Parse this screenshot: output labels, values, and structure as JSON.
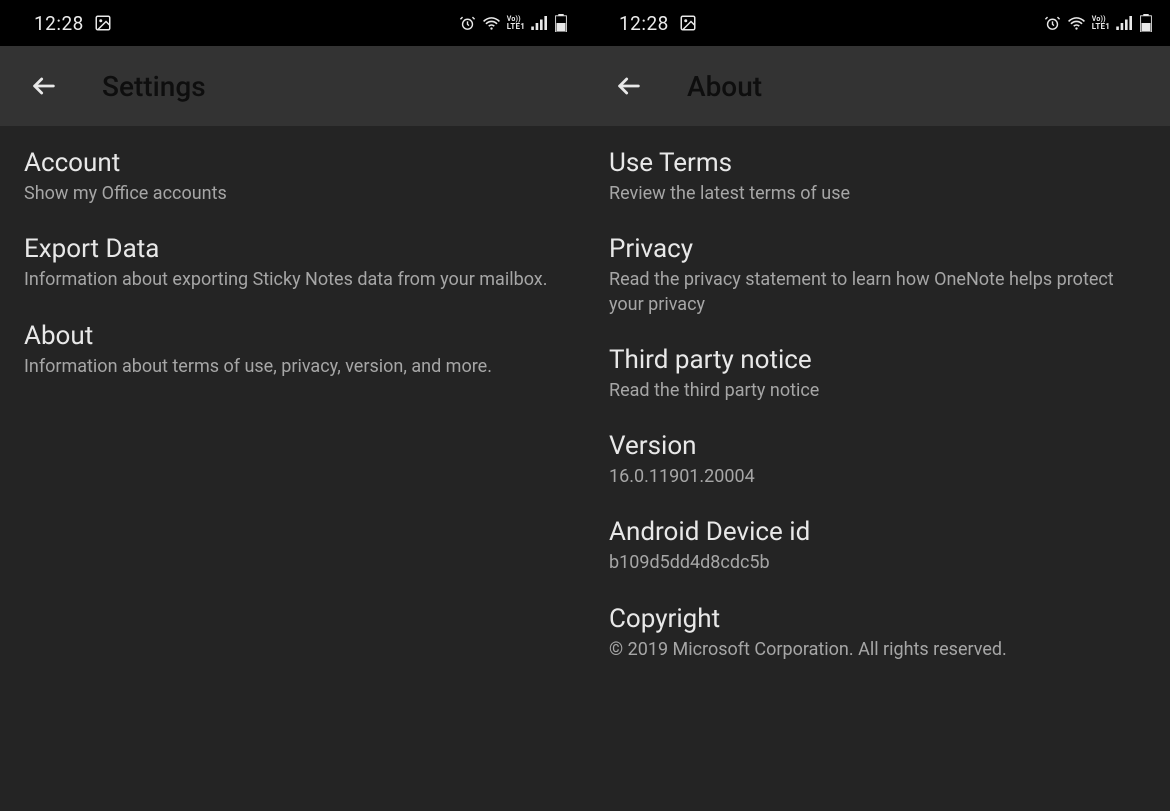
{
  "status": {
    "time": "12:28",
    "lte": "LTE1",
    "vo": "Vo))"
  },
  "left": {
    "appbar": {
      "title": "Settings"
    },
    "items": [
      {
        "title": "Account",
        "sub": "Show my Office accounts"
      },
      {
        "title": "Export Data",
        "sub": "Information about exporting Sticky Notes data from your mailbox."
      },
      {
        "title": "About",
        "sub": "Information about terms of use, privacy, version, and more."
      }
    ]
  },
  "right": {
    "appbar": {
      "title": "About"
    },
    "items": [
      {
        "title": "Use Terms",
        "sub": "Review the latest terms of use"
      },
      {
        "title": "Privacy",
        "sub": "Read the privacy statement to learn how OneNote helps protect your privacy"
      },
      {
        "title": "Third party notice",
        "sub": "Read the third party notice"
      },
      {
        "title": "Version",
        "sub": "16.0.11901.20004"
      },
      {
        "title": "Android Device id",
        "sub": "b109d5dd4d8cdc5b"
      },
      {
        "title": "Copyright",
        "sub": "© 2019 Microsoft Corporation. All rights reserved."
      }
    ]
  }
}
